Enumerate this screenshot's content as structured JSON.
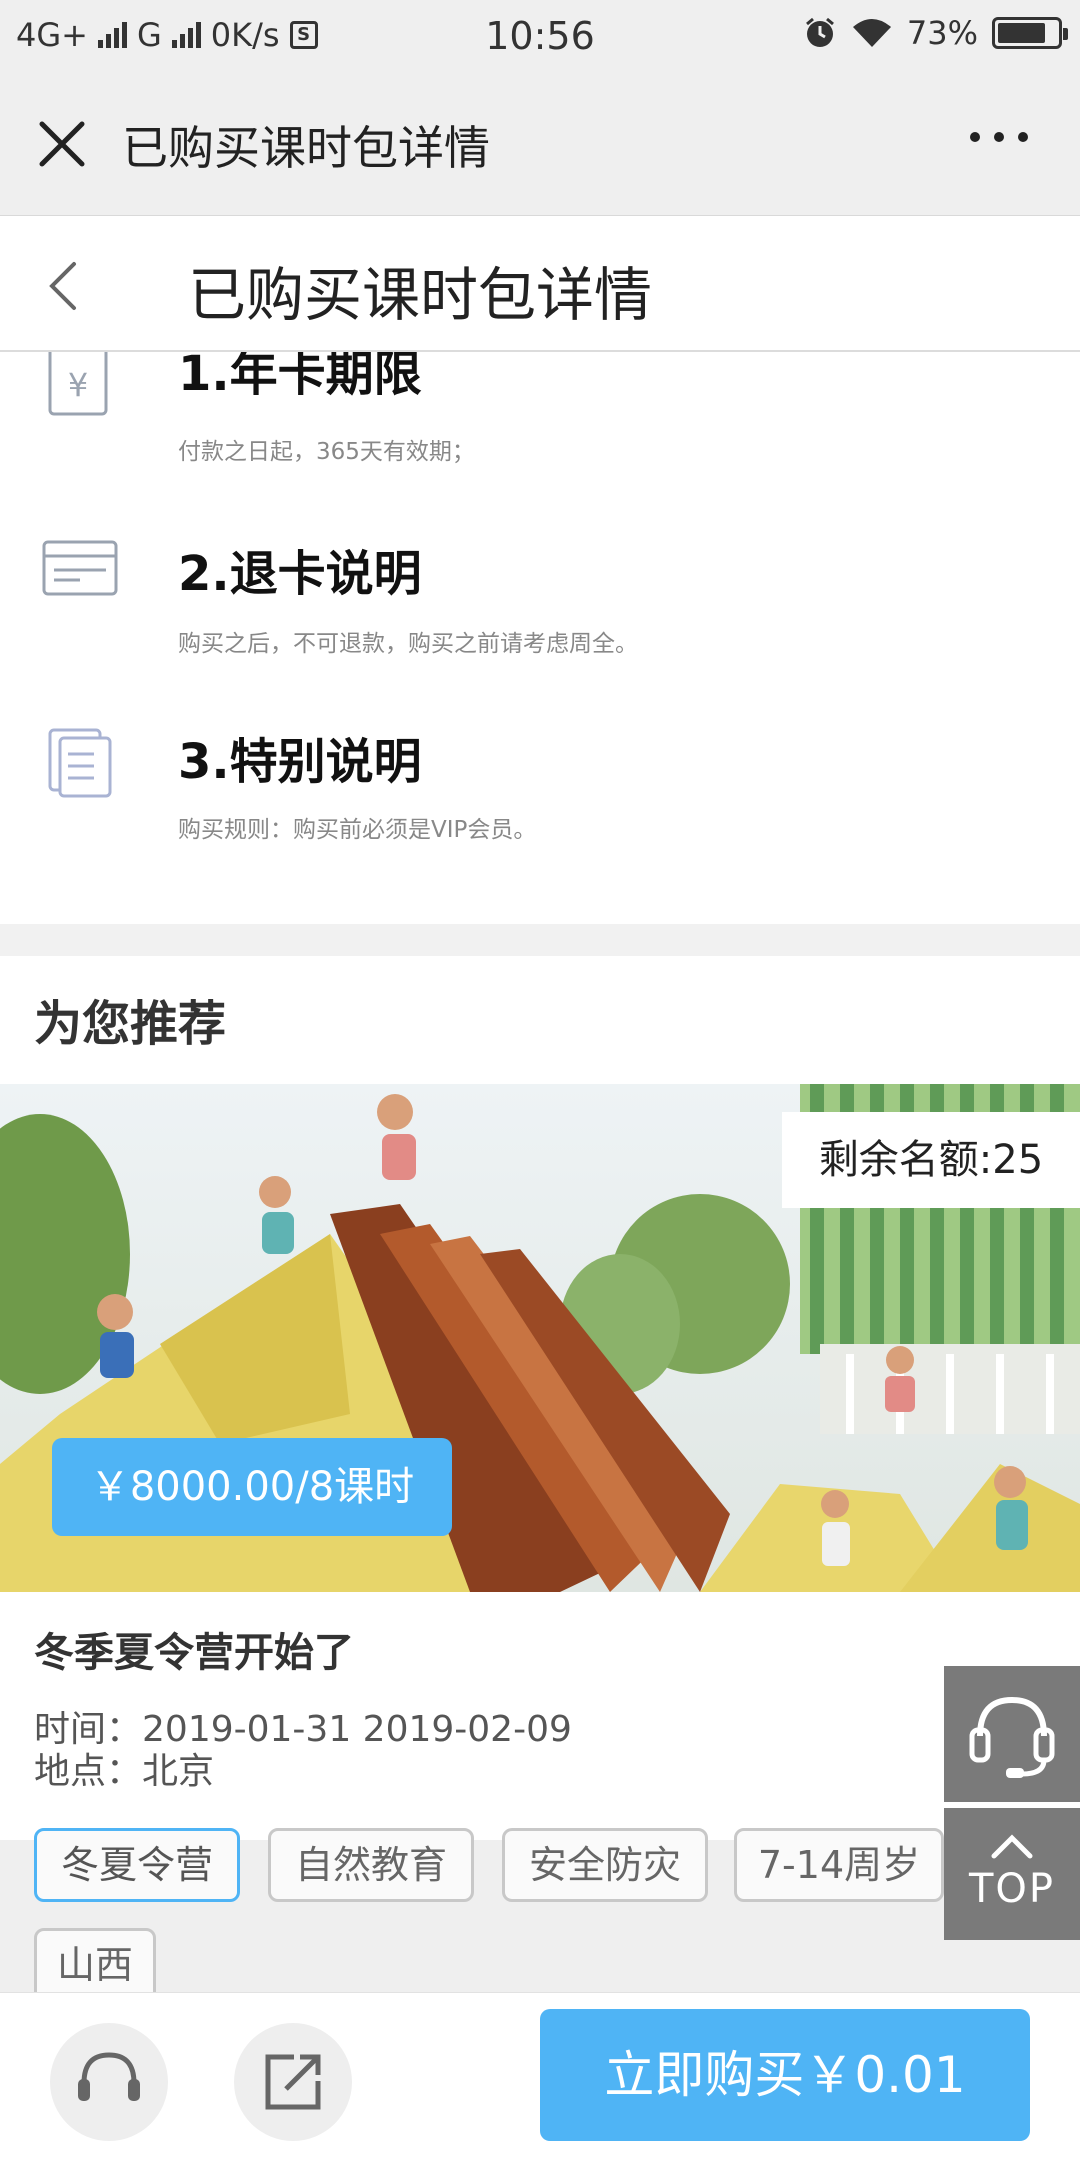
{
  "status_bar": {
    "network_1": "4G+",
    "network_2": "G",
    "speed": "0K/s",
    "s_icon": "S",
    "time": "10:56",
    "battery": "73%"
  },
  "wechat_header": {
    "title": "已购买课时包详情"
  },
  "page_header": {
    "title": "已购买课时包详情"
  },
  "notes": [
    {
      "title": "1.年卡期限",
      "desc": "付款之日起，365天有效期；",
      "icon": "yen-tag-icon"
    },
    {
      "title": "2.退卡说明",
      "desc": "购买之后，不可退款，购买之前请考虑周全。",
      "icon": "card-icon"
    },
    {
      "title": "3.特别说明",
      "desc": "购买规则：购买前必须是VIP会员。",
      "icon": "document-icon"
    }
  ],
  "recommend": {
    "title": "为您推荐",
    "quota": "剩余名额:25",
    "price": "￥8000.00/8课时",
    "event_title": "冬季夏令营开始了",
    "time_label": "时间：",
    "time_value": "2019-01-31 2019-02-09",
    "place_label": "地点：",
    "place_value": "北京",
    "tags": [
      "冬夏令营",
      "自然教育",
      "安全防灾",
      "7-14周岁",
      "山西"
    ]
  },
  "float": {
    "top_label": "TOP"
  },
  "bottom_bar": {
    "buy_label": "立即购买￥0.01"
  },
  "colors": {
    "accent": "#4fb4f5",
    "float_bg": "#7a7a7a"
  }
}
